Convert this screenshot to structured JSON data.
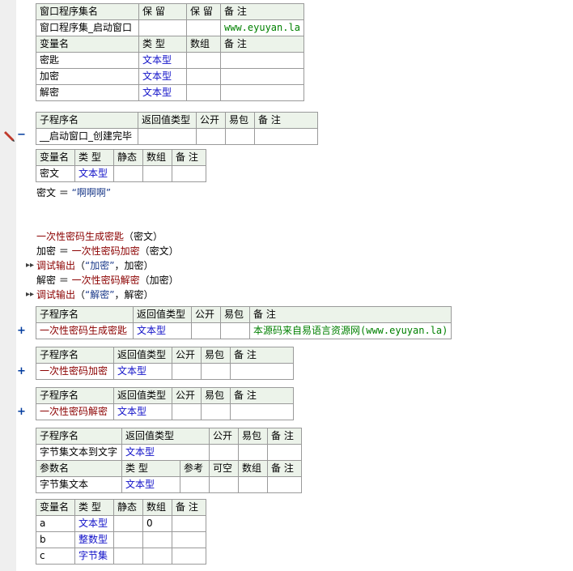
{
  "assembly": {
    "headers": [
      "窗口程序集名",
      "保 留",
      "保 留",
      "备 注"
    ],
    "row": [
      "窗口程序集_启动窗口",
      "",
      "",
      "www.eyuyan.la"
    ],
    "var_headers": [
      "变量名",
      "类 型",
      "数组",
      "备 注"
    ],
    "vars": [
      {
        "name": "密匙",
        "type": "文本型"
      },
      {
        "name": "加密",
        "type": "文本型"
      },
      {
        "name": "解密",
        "type": "文本型"
      }
    ]
  },
  "sub1": {
    "headers": [
      "子程序名",
      "返回值类型",
      "公开",
      "易包",
      "备 注"
    ],
    "name": "__启动窗口_创建完毕",
    "marker": "−",
    "var_headers": [
      "变量名",
      "类 型",
      "静态",
      "数组",
      "备 注"
    ],
    "vars": [
      {
        "name": "密文",
        "type": "文本型"
      }
    ]
  },
  "code": {
    "l1_var": "密文",
    "l1_eq": " ＝ ",
    "l1_str": "“啊啊啊”",
    "l2_fn": "一次性密码生成密匙",
    "l2_args": "（密文）",
    "l3_var": "加密",
    "l3_eq": " ＝ ",
    "l3_fn": "一次性密码加密",
    "l3_args": "（密文）",
    "l4_fn": "调试输出",
    "l4_open": "（",
    "l4_str": "“加密”",
    "l4_rest": "，加密）",
    "l5_var": "解密",
    "l5_eq": " ＝ ",
    "l5_fn": "一次性密码解密",
    "l5_args": "（加密）",
    "l6_fn": "调试输出",
    "l6_open": "（",
    "l6_str": "“解密”",
    "l6_rest": "，解密）",
    "bp": "▸▸"
  },
  "sub2": {
    "headers": [
      "子程序名",
      "返回值类型",
      "公开",
      "易包",
      "备 注"
    ],
    "name": "一次性密码生成密匙",
    "type": "文本型",
    "note": "本源码来自易语言资源网(www.eyuyan.la)",
    "marker": "+"
  },
  "sub3": {
    "headers": [
      "子程序名",
      "返回值类型",
      "公开",
      "易包",
      "备 注"
    ],
    "name": "一次性密码加密",
    "type": "文本型",
    "marker": "+"
  },
  "sub4": {
    "headers": [
      "子程序名",
      "返回值类型",
      "公开",
      "易包",
      "备 注"
    ],
    "name": "一次性密码解密",
    "type": "文本型",
    "marker": "+"
  },
  "sub5": {
    "headers": [
      "子程序名",
      "返回值类型",
      "公开",
      "易包",
      "备 注"
    ],
    "name": "字节集文本到文字",
    "type": "文本型",
    "param_headers": [
      "参数名",
      "类 型",
      "参考",
      "可空",
      "数组",
      "备 注"
    ],
    "param": {
      "name": "字节集文本",
      "type": "文本型"
    },
    "var_headers": [
      "变量名",
      "类 型",
      "静态",
      "数组",
      "备 注"
    ],
    "vars": [
      {
        "name": "a",
        "type": "文本型",
        "array": "0"
      },
      {
        "name": "b",
        "type": "整数型",
        "array": ""
      },
      {
        "name": "c",
        "type": "字节集",
        "array": ""
      }
    ]
  }
}
